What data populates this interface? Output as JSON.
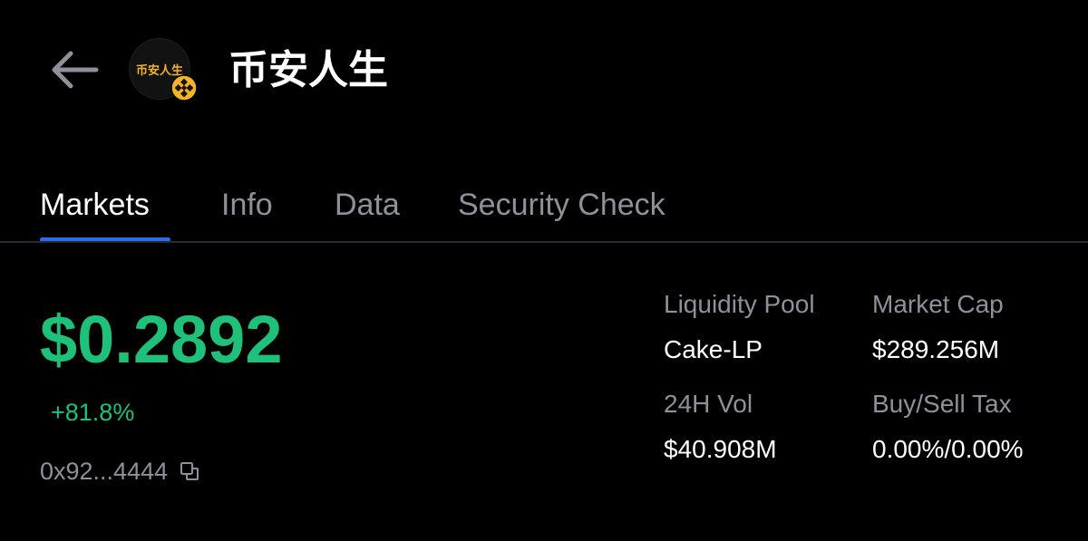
{
  "header": {
    "back_icon": "arrow-left-icon",
    "avatar_text": "币安人生",
    "chain_badge_icon": "bnb-chain-icon",
    "token_name": "币安人生"
  },
  "tabs": [
    {
      "label": "Markets",
      "active": true
    },
    {
      "label": "Info",
      "active": false
    },
    {
      "label": "Data",
      "active": false
    },
    {
      "label": "Security Check",
      "active": false
    }
  ],
  "market": {
    "price": "$0.2892",
    "change": "+81.8%",
    "address": "0x92...4444",
    "copy_icon": "copy-icon"
  },
  "stats": {
    "liquidity_pool": {
      "label": "Liquidity Pool",
      "value": "Cake-LP"
    },
    "market_cap": {
      "label": "Market Cap",
      "value": "$289.256M"
    },
    "vol_24h": {
      "label": "24H Vol",
      "value": "$40.908M"
    },
    "tax": {
      "label": "Buy/Sell Tax",
      "value": "0.00%/0.00%"
    }
  },
  "colors": {
    "background": "#000000",
    "positive": "#1fc07a",
    "accent": "#2f6bf0",
    "muted_text": "#8e919b",
    "badge": "#f3b32a"
  }
}
